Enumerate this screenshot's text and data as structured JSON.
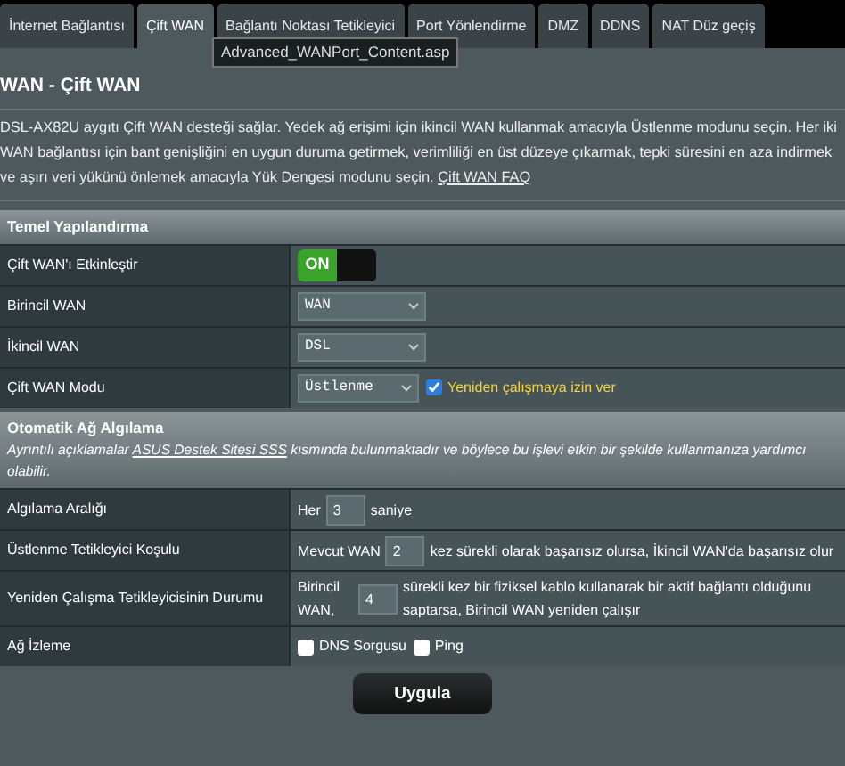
{
  "tabs": [
    {
      "label": "İnternet Bağlantısı",
      "selected": false
    },
    {
      "label": "Çift WAN",
      "selected": true
    },
    {
      "label": "Bağlantı Noktası Tetikleyici",
      "selected": false
    },
    {
      "label": "Port Yönlendirme",
      "selected": false
    },
    {
      "label": "DMZ",
      "selected": false
    },
    {
      "label": "DDNS",
      "selected": false
    },
    {
      "label": "NAT Düz geçiş",
      "selected": false
    }
  ],
  "tooltip": "Advanced_WANPort_Content.asp",
  "title": "WAN - Çift WAN",
  "intro": {
    "text": "DSL-AX82U aygıtı Çift WAN desteği sağlar. Yedek ağ erişimi için ikincil WAN kullanmak amacıyla Üstlenme modunu seçin. Her iki WAN bağlantısı için bant genişliğini en uygun duruma getirmek, verimliliği en üst düzeye çıkarmak, tepki süresini en aza indirmek ve aşırı veri yükünü önlemek amacıyla Yük Dengesi modunu seçin.",
    "link": "Çift WAN FAQ"
  },
  "sections": [
    {
      "title": "Temel Yapılandırma",
      "rows": [
        {
          "kind": "toggle",
          "label": "Çift WAN'ı Etkinleştir",
          "on": true,
          "on_label": "ON"
        },
        {
          "kind": "select",
          "label": "Birincil WAN",
          "value": "WAN"
        },
        {
          "kind": "select",
          "label": "İkincil WAN",
          "value": "DSL"
        },
        {
          "kind": "select",
          "label": "Çift WAN Modu",
          "value": "Üstlenme",
          "checks": [
            {
              "label": "Yeniden çalışmaya izin ver",
              "checked": true
            }
          ]
        }
      ]
    },
    {
      "title": "Otomatik Ağ Algılama",
      "description": {
        "before": "Ayrıntılı açıklamalar",
        "link": "ASUS Destek Sitesi SSS",
        "after": "kısmında bulunmaktadır ve böylece bu işlevi etkin bir şekilde kullanmanıza yardımcı olabilir."
      },
      "rows": [
        {
          "kind": "inline",
          "label": "Algılama Aralığı",
          "parts": [
            {
              "text": "Her"
            },
            {
              "input": "3"
            },
            {
              "text": "saniye"
            }
          ]
        },
        {
          "kind": "inline",
          "label": "Üstlenme Tetikleyici Koşulu",
          "parts": [
            {
              "text": "Mevcut WAN"
            },
            {
              "input": "2"
            },
            {
              "text": "kez sürekli olarak başarısız olursa, İkincil WAN'da başarısız olur"
            }
          ]
        },
        {
          "kind": "inline",
          "label": "Yeniden Çalışma Tetikleyicisinin Durumu",
          "parts": [
            {
              "text": "Birincil WAN,"
            },
            {
              "input": "4"
            },
            {
              "text": "sürekli kez bir fiziksel kablo kullanarak bir aktif bağlantı olduğunu saptarsa, Birincil WAN yeniden çalışır"
            }
          ]
        },
        {
          "kind": "checks",
          "label": "Ağ İzleme",
          "checks": [
            {
              "label": "DNS Sorgusu",
              "checked": false
            },
            {
              "label": "Ping",
              "checked": false
            }
          ]
        }
      ]
    }
  ],
  "apply_button": "Uygula"
}
